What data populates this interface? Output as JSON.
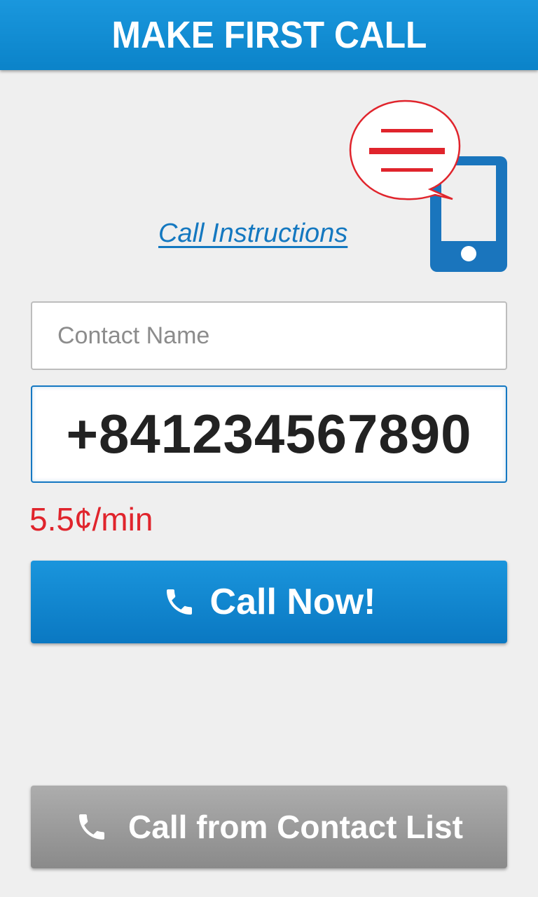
{
  "header": {
    "title": "MAKE FIRST CALL"
  },
  "instructions": {
    "link_label": "Call Instructions",
    "icon": "phone-chat-bubble-icon"
  },
  "form": {
    "contact_name": {
      "value": "",
      "placeholder": "Contact Name"
    },
    "phone_number": {
      "value": "+841234567890"
    },
    "rate": "5.5¢/min"
  },
  "buttons": {
    "call_now": {
      "label": "Call Now!",
      "icon": "phone-icon"
    },
    "call_from_contacts": {
      "label": "Call from Contact List",
      "icon": "phone-icon"
    }
  },
  "colors": {
    "primary": "#0b83c9",
    "accent_red": "#e0242c",
    "gray_button": "#9c9c9c"
  }
}
